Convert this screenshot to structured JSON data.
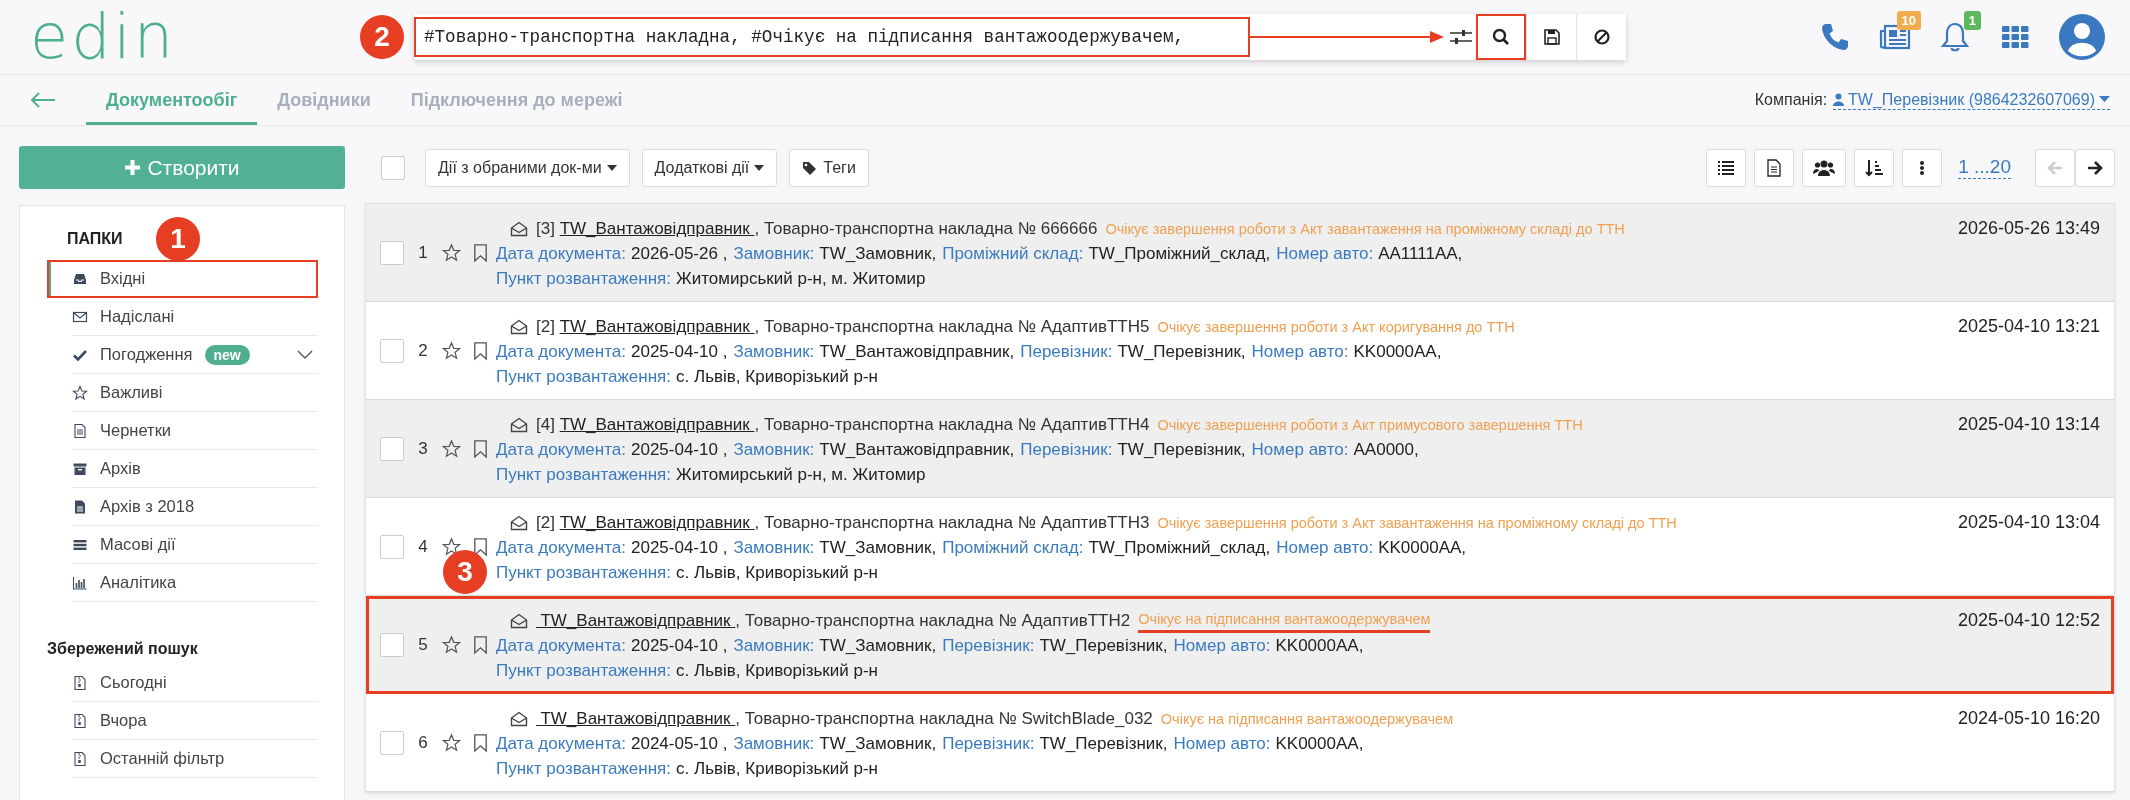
{
  "header": {
    "logo": "edin",
    "search": {
      "marker": "2",
      "value": "#Товарно-транспортна накладна, #Очікує на підписання вантажоодержувачем,",
      "highlighted": true,
      "search_highlighted": true
    },
    "badges": [
      {
        "kind": "phone"
      },
      {
        "kind": "news",
        "count": "10",
        "color": "#f0ad4e"
      },
      {
        "kind": "bell",
        "count": "1",
        "color": "#5cb85c"
      },
      {
        "kind": "apps"
      },
      {
        "kind": "avatar"
      }
    ]
  },
  "nav": {
    "tabs": [
      {
        "label": "Документообіг",
        "selected": true
      },
      {
        "label": "Довідники",
        "selected": false
      },
      {
        "label": "Підключення до мережі",
        "selected": false
      }
    ],
    "company_label": "Компанія:",
    "company": "TW_Перевізник (9864232607069)"
  },
  "sidebar": {
    "create": "Створити",
    "marker": "1",
    "folders_title": "ПАПКИ",
    "folders": [
      {
        "label": "Вхідні",
        "selected": true,
        "highlighted": true
      },
      {
        "label": "Надіслані",
        "selected": false
      },
      {
        "label": "Погодження",
        "selected": false,
        "badge": "new",
        "expanded": false
      },
      {
        "label": "Важливі",
        "selected": false
      },
      {
        "label": "Чернетки",
        "selected": false
      },
      {
        "label": "Архів",
        "selected": false
      },
      {
        "label": "Архів з 2018",
        "selected": false
      },
      {
        "label": "Масові дії",
        "selected": false
      },
      {
        "label": "Аналітика",
        "selected": false
      }
    ],
    "saved_title": "Збережений пошук",
    "saved": [
      {
        "label": "Сьогодні"
      },
      {
        "label": "Вчора"
      },
      {
        "label": "Останній фільтр"
      }
    ]
  },
  "toolbar": {
    "checked": false,
    "actions": [
      "Дії з обраними док-ми",
      "Додаткові дії"
    ],
    "tags": "Теги",
    "pagination": "1 ...20",
    "prev_disabled": true,
    "next_disabled": false
  },
  "rows": [
    {
      "number": "1",
      "checked": false,
      "prefix": "[3]",
      "sender": "TW_Вантажовідправник ",
      "doc": ", Товарно-транспортна накладна № 666666",
      "status": "Очікує завершення роботи з Акт завантаження на проміжному складі до ТТН",
      "underlined": false,
      "highlighted": false,
      "date": "2026-05-26 13:49",
      "fields": [
        {
          "label": "Дата документа:",
          "value": "2026-05-26 ,"
        },
        {
          "label": "Замовник:",
          "value": "TW_Замовник,"
        },
        {
          "label": "Проміжний склад:",
          "value": "TW_Проміжний_склад,"
        },
        {
          "label": "Номер авто:",
          "value": "AA1111AA,"
        }
      ],
      "place": {
        "label": "Пункт розвантаження:",
        "value": "Житомирський р-н, м. Житомир"
      }
    },
    {
      "number": "2",
      "checked": false,
      "prefix": "[2]",
      "sender": "TW_Вантажовідправник ",
      "doc": ", Товарно-транспортна накладна № АдаптивТТН5",
      "status": "Очікує завершення роботи з Акт коригування до ТТН",
      "underlined": false,
      "highlighted": false,
      "date": "2025-04-10 13:21",
      "fields": [
        {
          "label": "Дата документа:",
          "value": "2025-04-10 ,"
        },
        {
          "label": "Замовник:",
          "value": "TW_Вантажовідправник,"
        },
        {
          "label": "Перевізник:",
          "value": "TW_Перевізник,"
        },
        {
          "label": "Номер авто:",
          "value": "KK0000AA,"
        }
      ],
      "place": {
        "label": "Пункт розвантаження:",
        "value": "с. Львів, Криворізький р-н"
      }
    },
    {
      "number": "3",
      "checked": false,
      "prefix": "[4]",
      "sender": "TW_Вантажовідправник ",
      "doc": ", Товарно-транспортна накладна № АдаптивТТН4",
      "status": "Очікує завершення роботи з Акт примусового завершення ТТН",
      "underlined": false,
      "highlighted": false,
      "date": "2025-04-10 13:14",
      "fields": [
        {
          "label": "Дата документа:",
          "value": "2025-04-10 ,"
        },
        {
          "label": "Замовник:",
          "value": "TW_Вантажовідправник,"
        },
        {
          "label": "Перевізник:",
          "value": "TW_Перевізник,"
        },
        {
          "label": "Номер авто:",
          "value": "AA0000,"
        }
      ],
      "place": {
        "label": "Пункт розвантаження:",
        "value": "Житомирський р-н, м. Житомир"
      }
    },
    {
      "number": "4",
      "checked": false,
      "prefix": "[2]",
      "sender": "TW_Вантажовідправник ",
      "doc": ", Товарно-транспортна накладна № АдаптивТТН3",
      "status": "Очікує завершення роботи з Акт завантаження на проміжному складі до ТТН",
      "underlined": false,
      "highlighted": false,
      "date": "2025-04-10 13:04",
      "fields": [
        {
          "label": "Дата документа:",
          "value": "2025-04-10 ,"
        },
        {
          "label": "Замовник:",
          "value": "TW_Замовник,"
        },
        {
          "label": "Проміжний склад:",
          "value": "TW_Проміжний_склад,"
        },
        {
          "label": "Номер авто:",
          "value": "KK0000AA,"
        }
      ],
      "place": {
        "label": "Пункт розвантаження:",
        "value": "с. Львів, Криворізький р-н"
      }
    },
    {
      "number": "5",
      "checked": false,
      "marker": "3",
      "sender": " TW_Вантажовідправник ",
      "doc": ", Товарно-транспортна накладна № АдаптивТТН2",
      "status": "Очікує на підписання вантажоодержувачем",
      "underlined": true,
      "highlighted": true,
      "date": "2025-04-10 12:52",
      "fields": [
        {
          "label": "Дата документа:",
          "value": "2025-04-10 ,"
        },
        {
          "label": "Замовник:",
          "value": "TW_Замовник,"
        },
        {
          "label": "Перевізник:",
          "value": "TW_Перевізник,"
        },
        {
          "label": "Номер авто:",
          "value": "KK0000AA,"
        }
      ],
      "place": {
        "label": "Пункт розвантаження:",
        "value": "с. Львів, Криворізький р-н"
      }
    },
    {
      "number": "6",
      "checked": false,
      "sender": " TW_Вантажовідправник ",
      "doc": ", Товарно-транспортна накладна № SwitchBlade_032",
      "status": "Очікує на підписання вантажоодержувачем",
      "underlined": false,
      "highlighted": false,
      "date": "2024-05-10 16:20",
      "fields": [
        {
          "label": "Дата документа:",
          "value": "2024-05-10 ,"
        },
        {
          "label": "Замовник:",
          "value": "TW_Замовник,"
        },
        {
          "label": "Перевізник:",
          "value": "TW_Перевізник,"
        },
        {
          "label": "Номер авто:",
          "value": "KK0000AA,"
        }
      ],
      "place": {
        "label": "Пункт розвантаження:",
        "value": "с. Львів, Криворізький р-н"
      }
    }
  ]
}
